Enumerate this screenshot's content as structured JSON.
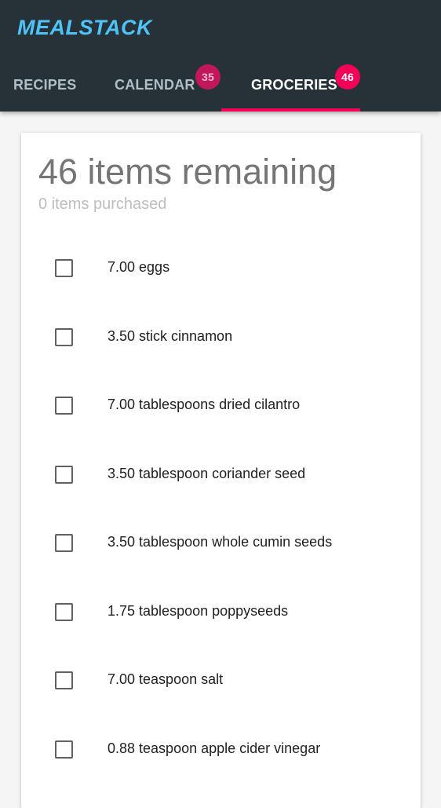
{
  "app": {
    "title": "MEALSTACK"
  },
  "tabs": [
    {
      "label": "RECIPES",
      "active": false
    },
    {
      "label": "CALENDAR",
      "badge": "35",
      "active": false
    },
    {
      "label": "GROCERIES",
      "badge": "46",
      "active": true
    }
  ],
  "summary": {
    "remaining": "46 items remaining",
    "purchased": "0 items purchased"
  },
  "items": [
    {
      "label": "7.00 eggs",
      "checked": false
    },
    {
      "label": "3.50 stick cinnamon",
      "checked": false
    },
    {
      "label": "7.00 tablespoons dried cilantro",
      "checked": false
    },
    {
      "label": "3.50 tablespoon coriander seed",
      "checked": false
    },
    {
      "label": "3.50 tablespoon whole cumin seeds",
      "checked": false
    },
    {
      "label": "1.75 tablespoon poppyseeds",
      "checked": false
    },
    {
      "label": "7.00 teaspoon salt",
      "checked": false
    },
    {
      "label": "0.88 teaspoon apple cider vinegar",
      "checked": false
    }
  ],
  "colors": {
    "appbar": "#263238",
    "brand": "#4fc3f7",
    "accent": "#f50057",
    "calendar_badge": "#c2185b"
  }
}
